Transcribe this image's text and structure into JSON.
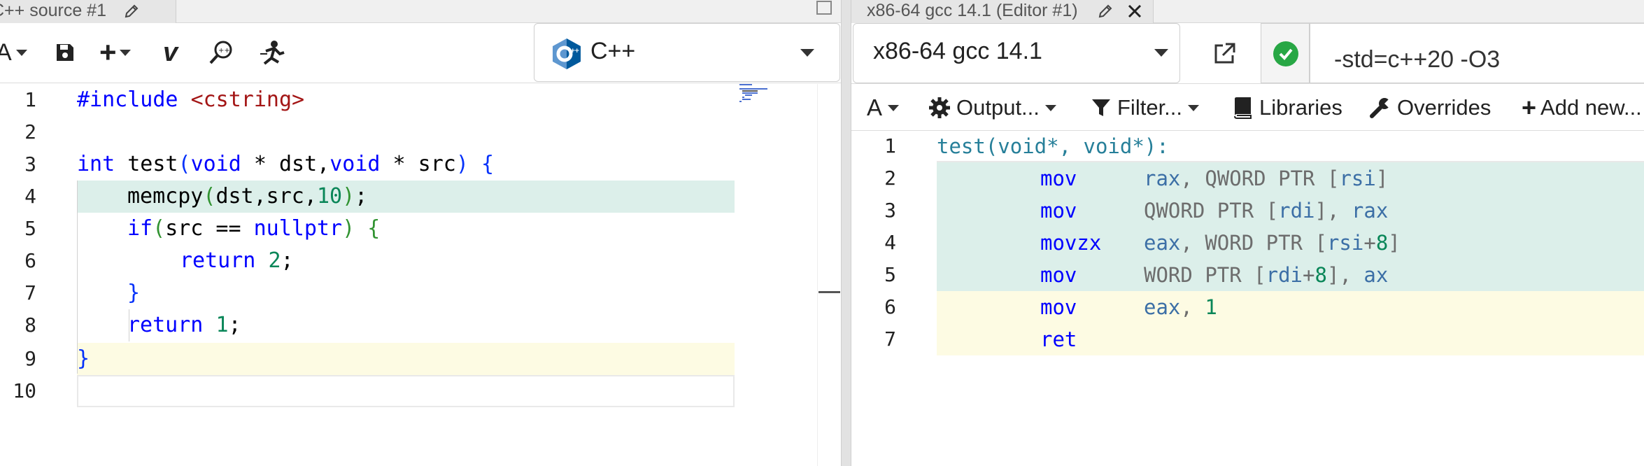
{
  "left_pane": {
    "tab_title": "C++ source #1",
    "language": "C++",
    "code_lines": [
      {
        "n": "1",
        "text": "#include <cstring>"
      },
      {
        "n": "2",
        "text": ""
      },
      {
        "n": "3",
        "text": "int test(void * dst,void * src) {"
      },
      {
        "n": "4",
        "text": "memcpy(dst,src,10);"
      },
      {
        "n": "5",
        "text": "if(src == nullptr) {"
      },
      {
        "n": "6",
        "text": "return 2;"
      },
      {
        "n": "7",
        "text": "}"
      },
      {
        "n": "8",
        "text": "return 1;"
      },
      {
        "n": "9",
        "text": "}"
      },
      {
        "n": "10",
        "text": ""
      }
    ],
    "toolbar": {
      "font_label": "A",
      "save_icon": "save-icon",
      "add_label": "+",
      "vim_label": "v",
      "search_icon": "cpp-insights-icon",
      "quickbench_icon": "quick-bench-icon"
    }
  },
  "right_pane": {
    "tab_title": "x86-64 gcc 14.1 (Editor #1)",
    "compiler": "x86-64 gcc 14.1",
    "compiler_options": "-std=c++20 -O3",
    "status_color": "#28a745",
    "toolbar": {
      "font_label": "A",
      "output": "Output...",
      "filter": "Filter...",
      "libraries": "Libraries",
      "overrides": "Overrides",
      "add_new": "Add new..."
    },
    "asm_lines": [
      {
        "n": "1",
        "label": "test(void*, void*):"
      },
      {
        "n": "2",
        "op": "mov",
        "args": "rax, QWORD PTR [rsi]"
      },
      {
        "n": "3",
        "op": "mov",
        "args": "QWORD PTR [rdi], rax"
      },
      {
        "n": "4",
        "op": "movzx",
        "args": "eax, WORD PTR [rsi+8]"
      },
      {
        "n": "5",
        "op": "mov",
        "args": "WORD PTR [rdi+8], ax"
      },
      {
        "n": "6",
        "op": "mov",
        "args": "eax, 1"
      },
      {
        "n": "7",
        "op": "ret",
        "args": ""
      }
    ]
  },
  "colors": {
    "highlight_green": "#dcefea",
    "highlight_yellow": "#fdfbe3",
    "keyword_blue": "#0000ff",
    "string_red": "#a31515",
    "number_green": "#098658"
  }
}
